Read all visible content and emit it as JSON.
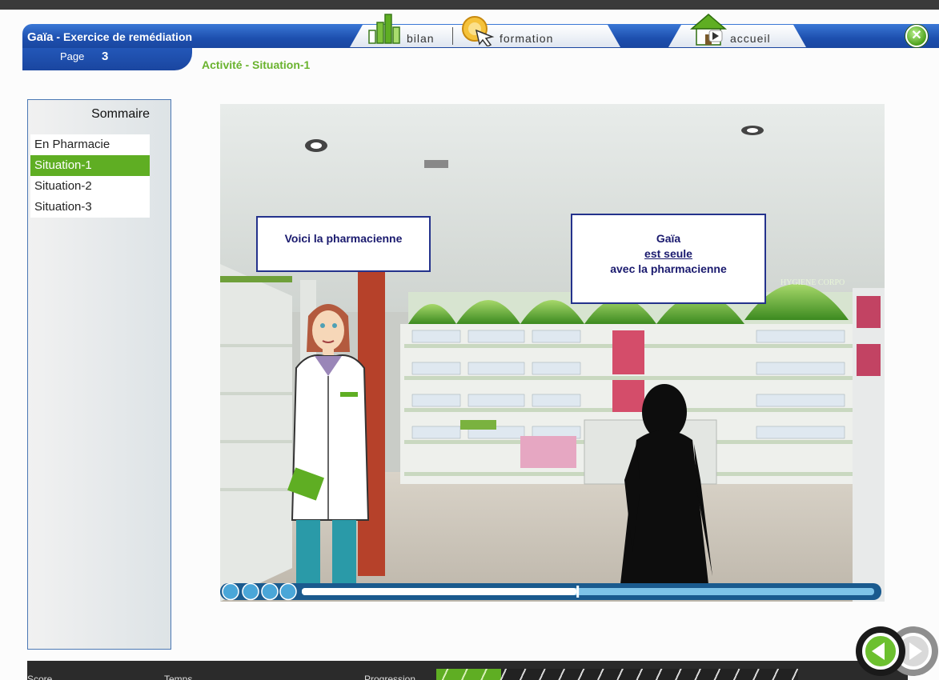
{
  "header": {
    "app_name": "Gaïa",
    "app_subtitle": " - Exercice de remédiation",
    "page_label": "Page",
    "page_number": "3",
    "activity_title": "Activité - Situation-1"
  },
  "nav_tabs": [
    {
      "label": "bilan",
      "icon": "chart-icon"
    },
    {
      "label": "formation",
      "icon": "cursor-icon"
    },
    {
      "label": "accueil",
      "icon": "home-icon"
    }
  ],
  "sidebar": {
    "title": "Sommaire",
    "items": [
      {
        "label": "En Pharmacie",
        "active": false
      },
      {
        "label": "Situation-1",
        "active": true
      },
      {
        "label": "Situation-2",
        "active": false
      },
      {
        "label": "Situation-3",
        "active": false
      }
    ]
  },
  "scene": {
    "bubble_left": "Voici la pharmacienne",
    "bubble_right_line1": "Gaïa",
    "bubble_right_link": "est seule",
    "bubble_right_line3": "avec la pharmacienne",
    "sign_text": "HYGIENE CORPO"
  },
  "player": {
    "progress": 0.48,
    "controls": [
      "pause-icon",
      "stop-icon",
      "rewind-icon",
      "forward-icon"
    ]
  },
  "footer": {
    "score_label": "Score",
    "time_label": "Temps",
    "progress_label": "Progression",
    "progress_fraction": 0.18
  },
  "colors": {
    "brand_blue": "#1d4fae",
    "accent_green": "#5fae23",
    "bubble_border": "#24328c"
  }
}
